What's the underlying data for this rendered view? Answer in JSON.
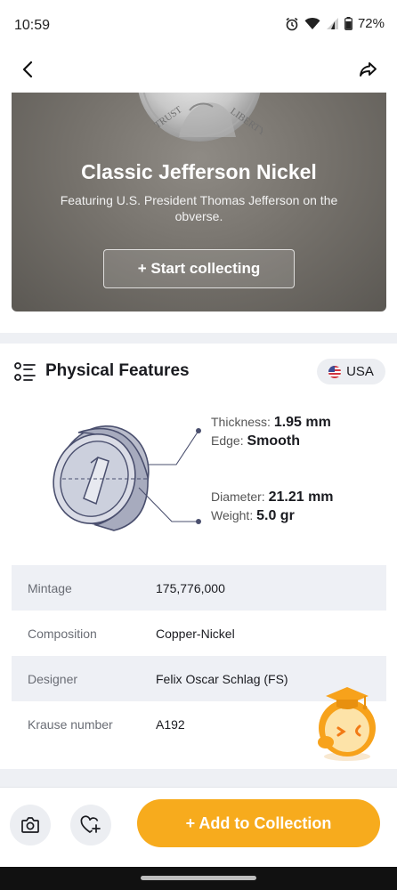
{
  "status_bar": {
    "time": "10:59",
    "battery": "72%"
  },
  "nav": {
    "back_icon": "chevron-left-icon",
    "share_icon": "share-forward-icon"
  },
  "hero": {
    "title": "Classic Jefferson Nickel",
    "subtitle": "Featuring U.S. President Thomas Jefferson on the obverse.",
    "coin_text_left": "TRUST",
    "coin_text_right": "LIBERTY",
    "start_button": "+ Start collecting"
  },
  "physical": {
    "title": "Physical Features",
    "country": "USA",
    "thickness_label": "Thickness:",
    "thickness_value": "1.95 mm",
    "edge_label": "Edge:",
    "edge_value": "Smooth",
    "diameter_label": "Diameter:",
    "diameter_value": "21.21 mm",
    "weight_label": "Weight:",
    "weight_value": "5.0 gr"
  },
  "details": [
    {
      "label": "Mintage",
      "value": "175,776,000"
    },
    {
      "label": "Composition",
      "value": "Copper-Nickel"
    },
    {
      "label": "Designer",
      "value": "Felix Oscar Schlag (FS)"
    },
    {
      "label": "Krause number",
      "value": "A192"
    }
  ],
  "bottom_bar": {
    "add_button": "+ Add to Collection"
  },
  "colors": {
    "accent": "#f7ab1d",
    "row_shade": "#eef0f5",
    "hero_bg": "#77736d"
  }
}
